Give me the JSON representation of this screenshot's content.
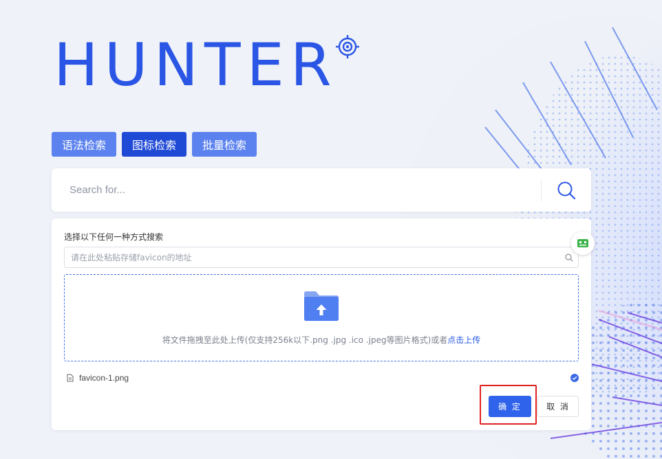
{
  "logo": {
    "text": "HUNTER"
  },
  "tabs": [
    {
      "label": "语法检索",
      "active": false
    },
    {
      "label": "图标检索",
      "active": true
    },
    {
      "label": "批量检索",
      "active": false
    }
  ],
  "search": {
    "placeholder": "Search for...",
    "value": ""
  },
  "panel": {
    "title": "选择以下任何一种方式搜索",
    "url_placeholder": "请在此处粘贴存储favicon的地址",
    "dropzone_text": "将文件拖拽至此处上传(仅支持256k以下.png .jpg .ico .jpeg等图片格式)或者",
    "dropzone_link": "点击上传",
    "file": {
      "name": "favicon-1.png",
      "status": "uploaded"
    },
    "confirm_label": "确 定",
    "cancel_label": "取 消"
  },
  "colors": {
    "brand": "#2a55e5",
    "tab": "#5b82ee",
    "tab_active": "#1f4ad6",
    "primary_button": "#2f63ec",
    "highlight": "#e02020",
    "helper_icon": "#3bb34a"
  },
  "icons": {
    "logo_mark": "crosshair-icon",
    "search": "search-icon",
    "url_search": "small-search-icon",
    "upload": "folder-upload-icon",
    "file": "document-icon",
    "status": "check-circle-icon",
    "helper": "robot-helper-icon"
  }
}
